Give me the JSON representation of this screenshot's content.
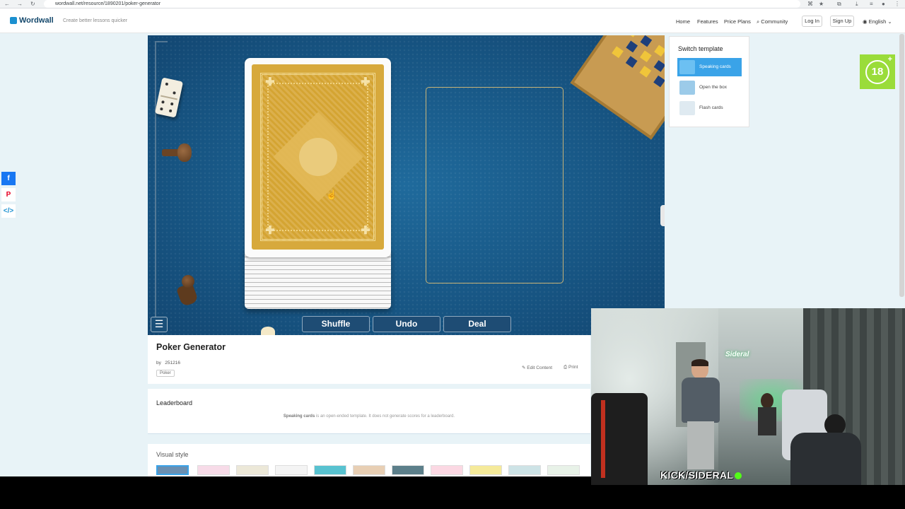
{
  "browser": {
    "url": "wordwall.net/resource/1890201/poker-generator"
  },
  "header": {
    "logo_text": "Wordwall",
    "tagline": "Create better lessons quicker",
    "nav": [
      "Home",
      "Features",
      "Price Plans",
      "Community"
    ],
    "login_label": "Log In",
    "signup_label": "Sign Up",
    "language_label": "English"
  },
  "activity": {
    "buttons": {
      "shuffle": "Shuffle",
      "undo": "Undo",
      "deal": "Deal"
    },
    "menu_icon": "☰"
  },
  "switch_template": {
    "title": "Switch template",
    "items": [
      {
        "label": "Speaking cards",
        "active": true
      },
      {
        "label": "Open the box",
        "active": false
      },
      {
        "label": "Flash cards",
        "active": false
      }
    ]
  },
  "age_badge": {
    "value": "18",
    "plus": "+"
  },
  "resource": {
    "title": "Poker Generator",
    "by_label": "by",
    "author": "251216",
    "tag": "Poker",
    "edit_label": "Edit Content",
    "print_label": "Print"
  },
  "leaderboard": {
    "title": "Leaderboard",
    "note_bold": "Speaking cards",
    "note_rest": " is an open-ended template. It does not generate scores for a leaderboard."
  },
  "visual_style": {
    "title": "Visual style"
  },
  "stream_overlay": {
    "channel": "KICK/SIDERAL",
    "neon_sign": "Sideral"
  },
  "colors": {
    "brand": "#1b90d0",
    "stage": "#175583",
    "active_template": "#3aa3e8",
    "age_badge": "#9adc3a",
    "kick_green": "#53fc18"
  }
}
